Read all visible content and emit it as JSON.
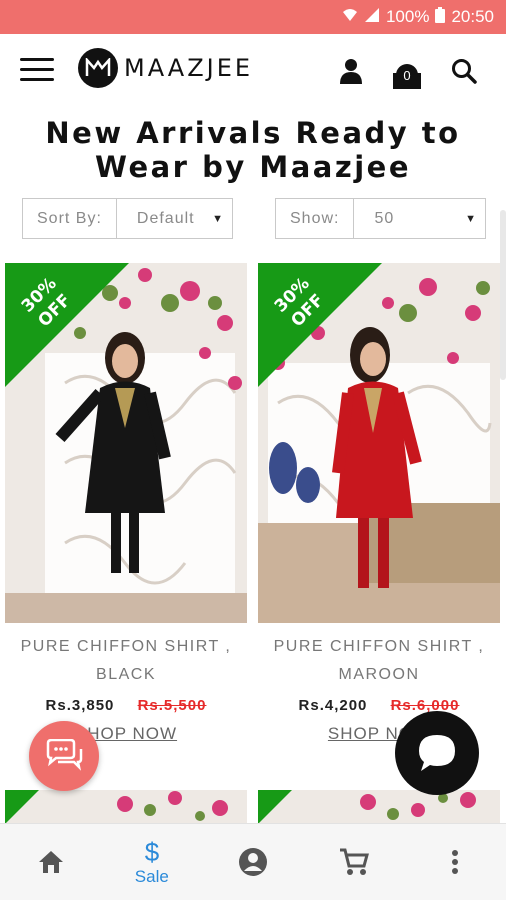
{
  "status_bar": {
    "battery": "100%",
    "time": "20:50",
    "icons": [
      "wifi-icon",
      "signal-icon",
      "battery-icon"
    ]
  },
  "header": {
    "brand": "MAAZJEE",
    "cart_count": "0",
    "icons": [
      "menu-icon",
      "user-icon",
      "cart-icon",
      "search-icon"
    ]
  },
  "page": {
    "title_line1": "New Arrivals Ready to",
    "title_line2": "Wear by Maazjee"
  },
  "filters": {
    "sort": {
      "label": "Sort By:",
      "value": "Default"
    },
    "show": {
      "label": "Show:",
      "value": "50"
    }
  },
  "products": [
    {
      "badge_line1": "30%",
      "badge_line2": "OFF",
      "name_line1": "PURE CHIFFON SHIRT ,",
      "name_line2": "BLACK",
      "price": "Rs.3,850",
      "old_price": "Rs.5,500",
      "cta": "SHOP NOW",
      "dress_color": "#151515"
    },
    {
      "badge_line1": "30%",
      "badge_line2": "OFF",
      "name_line1": "PURE CHIFFON SHIRT ,",
      "name_line2": "MAROON",
      "price": "Rs.4,200",
      "old_price": "Rs.6,000",
      "cta": "SHOP NOW",
      "dress_color": "#c8171e"
    }
  ],
  "bottom_nav": {
    "items": [
      "home-icon",
      "sale-icon",
      "account-icon",
      "cart-icon",
      "more-icon"
    ],
    "active_label": "Sale"
  },
  "colors": {
    "status_bar": "#ef6f6c",
    "badge": "#179a16",
    "old_price": "#e62a2a",
    "nav_active": "#2b8ad9",
    "chat_left": "#ef6f6c",
    "chat_right": "#111111"
  }
}
